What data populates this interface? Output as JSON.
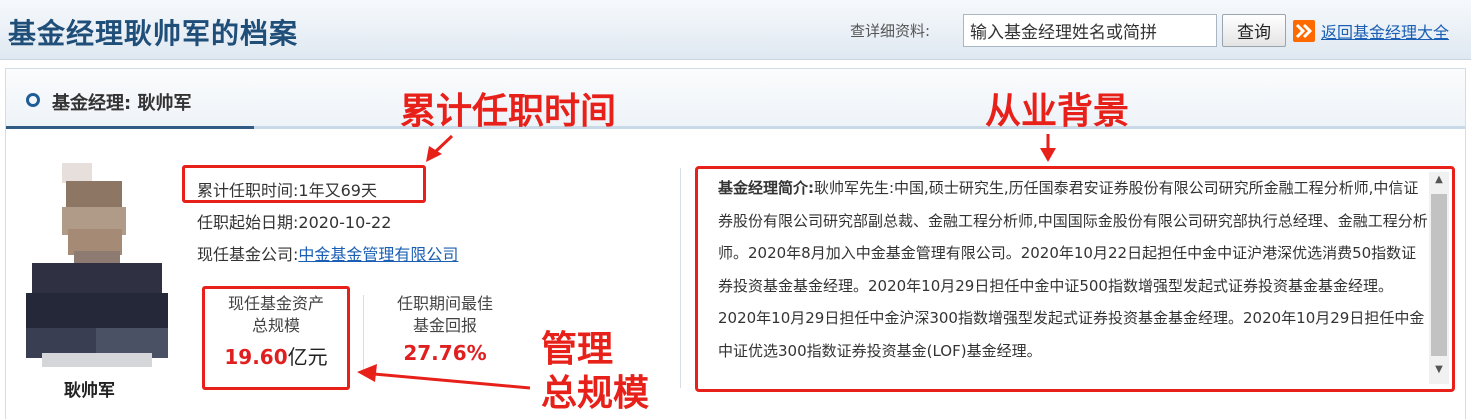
{
  "header": {
    "title": "基金经理耿帅军的档案",
    "search_label": "查详细资料:",
    "search_value": "输入基金经理姓名或简拼",
    "search_button": "查询",
    "back_link": "返回基金经理大全"
  },
  "panel": {
    "title": "基金经理: 耿帅军"
  },
  "manager": {
    "name": "耿帅军",
    "tenure_label": "累计任职时间:",
    "tenure_value": "1年又69天",
    "start_label": "任职起始日期:",
    "start_value": "2020-10-22",
    "company_label": "现任基金公司:",
    "company_value": "中金基金管理有限公司"
  },
  "metrics": {
    "assets_label_1": "现任基金资产",
    "assets_label_2": "总规模",
    "assets_value": "19.60",
    "assets_unit": "亿元",
    "return_label_1": "任职期间最佳",
    "return_label_2": "基金回报",
    "return_value": "27.76%"
  },
  "bio": {
    "title": "基金经理简介:",
    "text": "耿帅军先生:中国,硕士研究生,历任国泰君安证券股份有限公司研究所金融工程分析师,中信证券股份有限公司研究部副总裁、金融工程分析师,中国国际金股份有限公司研究部执行总经理、金融工程分析师。2020年8月加入中金基金管理有限公司。2020年10月22日起担任中金中证沪港深优选消费50指数证券投资基金基金经理。2020年10月29日担任中金中证500指数增强型发起式证券投资基金基金经理。2020年10月29日担任中金沪深300指数增强型发起式证券投资基金基金经理。2020年10月29日担任中金中证优选300指数证券投资基金(LOF)基金经理。"
  },
  "annotations": {
    "tenure": "累计任职时间",
    "background": "从业背景",
    "scale_line1": "管理",
    "scale_line2": "总规模"
  },
  "colors": {
    "accent_red": "#e8201a",
    "title_blue": "#1f4e79",
    "link_blue": "#1a5fb4"
  }
}
